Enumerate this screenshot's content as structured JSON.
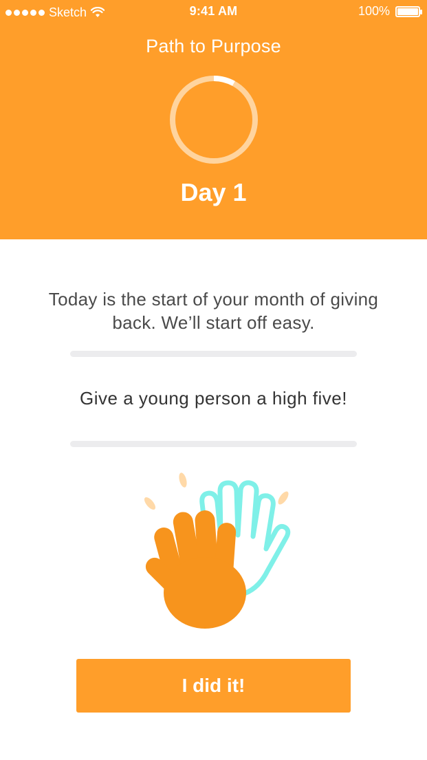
{
  "status_bar": {
    "carrier": "Sketch",
    "time": "9:41 AM",
    "battery_percent": "100%",
    "battery_level": 1.0,
    "signal_bars": 5
  },
  "header": {
    "title": "Path to Purpose",
    "progress_fraction": 0.08,
    "day_label": "Day 1"
  },
  "content": {
    "intro": "Today is the start of your month of giving back. We’ll start off easy.",
    "challenge": "Give a young person a high five!",
    "illustration": "high-five-hands"
  },
  "actions": {
    "done_label": "I did it!"
  },
  "colors": {
    "primary": "#FF9E2A",
    "hand_primary": "#F7941D",
    "hand_outline": "#7FF0E8",
    "accent_spark": "#FFD9A8",
    "text_body": "#4a4a4a",
    "divider": "#ECECEE"
  }
}
